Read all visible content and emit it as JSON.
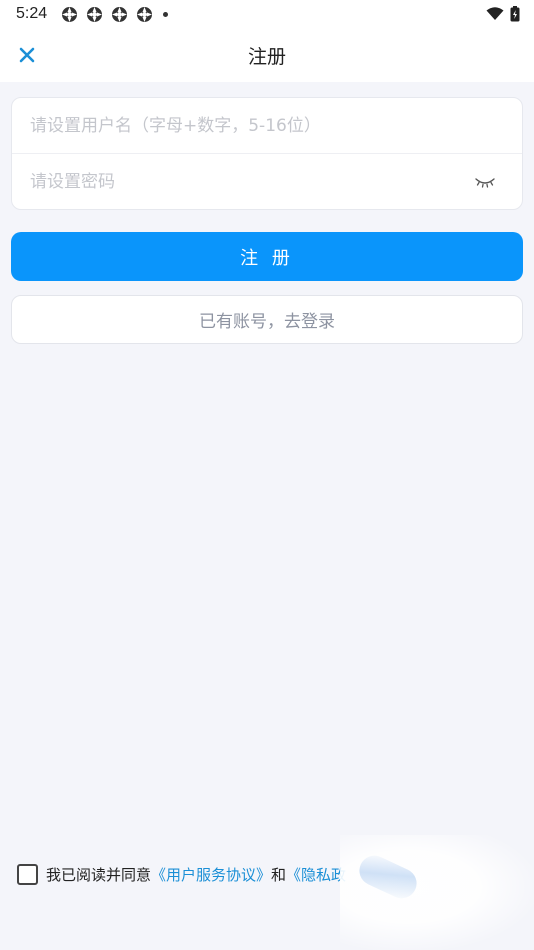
{
  "status_bar": {
    "time": "5:24"
  },
  "header": {
    "title": "注册",
    "close_icon": "close-icon"
  },
  "form": {
    "username": {
      "placeholder": "请设置用户名（字母+数字，5-16位）",
      "value": ""
    },
    "password": {
      "placeholder": "请设置密码",
      "value": "",
      "toggle_icon": "eye-closed-icon"
    }
  },
  "actions": {
    "register_label": "注 册",
    "login_label": "已有账号，去登录"
  },
  "agreement": {
    "text": "我已阅读并同意",
    "service_link": "《用户服务协议》",
    "and": "和",
    "privacy_link": "《隐私政"
  },
  "colors": {
    "primary": "#0a95fb",
    "link": "#1b8fd6",
    "background": "#f4f5fa",
    "close_icon": "#1b8fd6"
  }
}
